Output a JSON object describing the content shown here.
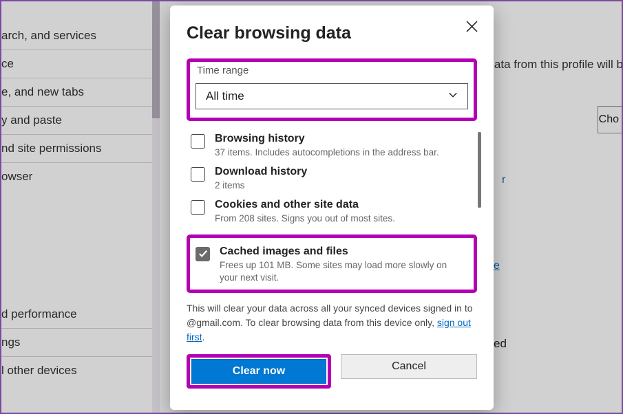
{
  "sidebar": {
    "items": [
      "arch, and services",
      "ce",
      "e, and new tabs",
      "y and paste",
      "nd site permissions",
      "owser",
      "d performance",
      "ngs",
      "l other devices"
    ]
  },
  "rightbg": {
    "profile_note": "data from this profile will b",
    "choose_label": "Cho",
    "link_letter": "r",
    "link_e": "e",
    "ed_text": "ed"
  },
  "dialog": {
    "title": "Clear browsing data",
    "time_label": "Time range",
    "time_value": "All time",
    "items": [
      {
        "title": "Browsing history",
        "desc": "37 items. Includes autocompletions in the address bar.",
        "checked": false
      },
      {
        "title": "Download history",
        "desc": "2 items",
        "checked": false
      },
      {
        "title": "Cookies and other site data",
        "desc": "From 208 sites. Signs you out of most sites.",
        "checked": false
      },
      {
        "title": "Cached images and files",
        "desc": "Frees up 101 MB. Some sites may load more slowly on your next visit.",
        "checked": true
      }
    ],
    "sync_note_1": "This will clear your data across all your synced devices signed in to ",
    "sync_note_2": "@gmail.com. To clear browsing data from this device only, ",
    "sign_out": "sign out first",
    "period": ".",
    "clear_label": "Clear now",
    "cancel_label": "Cancel"
  }
}
